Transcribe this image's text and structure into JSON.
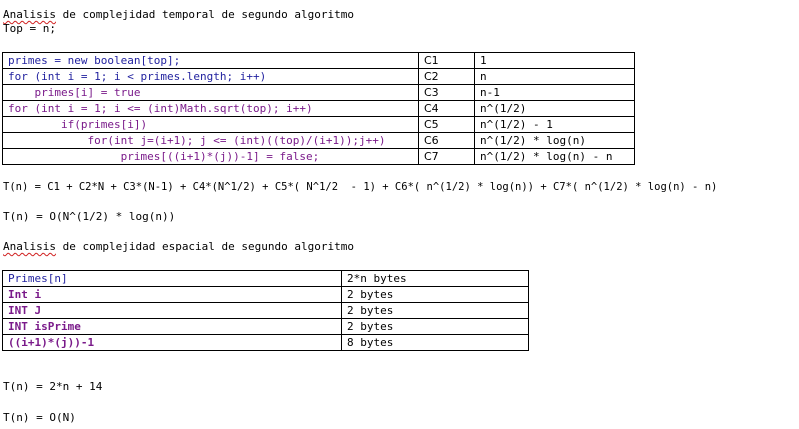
{
  "temporal": {
    "heading_first_word": "Analisis",
    "heading_rest": " de complejidad temporal de segundo algoritmo",
    "top_line": "Top = n;",
    "rows": [
      {
        "code": "primes = new boolean[top];",
        "label": "C1",
        "cost": "1"
      },
      {
        "code": "for (int i = 1; i < primes.length; i++)",
        "label": "C2",
        "cost": "n"
      },
      {
        "code": "    primes[i] = true",
        "label": "C3",
        "cost": "n-1"
      },
      {
        "code": "for (int i = 1; i <= (int)Math.sqrt(top); i++)",
        "label": "C4",
        "cost": "n^(1/2)"
      },
      {
        "code": "        if(primes[i])",
        "label": "C5",
        "cost": "n^(1/2) - 1"
      },
      {
        "code": "            for(int j=(i+1); j <= (int)((top)/(i+1));j++)",
        "label": "C6",
        "cost": "n^(1/2) * log(n)"
      },
      {
        "code": "                 primes[((i+1)*(j))-1] = false;",
        "label": "C7",
        "cost": "n^(1/2) * log(n) - n"
      }
    ],
    "equation": "T(n) = C1 + C2*N + C3*(N-1) + C4*(N^1/2) + C5*( N^1/2  - 1) + C6*( n^(1/2) * log(n)) + C7*( n^(1/2) * log(n) - n)",
    "result": "T(n) = O(N^(1/2) * log(n))"
  },
  "spatial": {
    "heading_first_word": "Analisis",
    "heading_rest": " de complejidad espacial de segundo algoritmo",
    "rows": [
      {
        "name": "Primes[n]",
        "size": "2*n bytes"
      },
      {
        "name": "Int i",
        "size": "2 bytes"
      },
      {
        "name": "INT J",
        "size": "2 bytes"
      },
      {
        "name": "INT isPrime",
        "size": "2 bytes"
      },
      {
        "name": "((i+1)*(j))-1",
        "size": "8 bytes"
      }
    ],
    "equation": "T(n) = 2*n + 14",
    "result": "T(n) = O(N)"
  },
  "colors": {
    "code": "#7a1a8a",
    "keyword_blue": "#1f1f9e",
    "spellcheck": "#d02020"
  }
}
